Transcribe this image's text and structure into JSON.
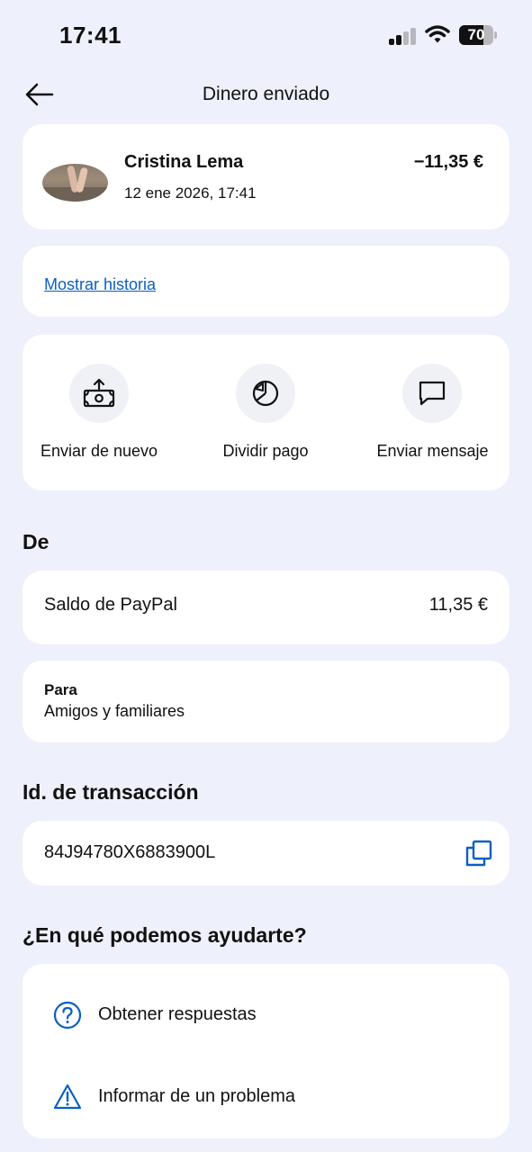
{
  "status_bar": {
    "time": "17:41",
    "battery": "70",
    "battery_level": 0.7
  },
  "header": {
    "title": "Dinero enviado"
  },
  "transaction": {
    "name": "Cristina Lema",
    "date": "12 ene 2026, 17:41",
    "amount": "−11,35 €"
  },
  "history": {
    "link": "Mostrar historia"
  },
  "actions": [
    {
      "label": "Enviar de nuevo",
      "icon": "money-send-icon"
    },
    {
      "label": "Dividir pago",
      "icon": "pie-chart-icon"
    },
    {
      "label": "Enviar mensaje",
      "icon": "message-icon"
    }
  ],
  "from": {
    "title": "De",
    "source": "Saldo de PayPal",
    "amount": "11,35 €"
  },
  "purpose": {
    "label": "Para",
    "value": "Amigos y familiares"
  },
  "transaction_id": {
    "title": "Id. de transacción",
    "value": "84J94780X6883900L"
  },
  "help": {
    "title": "¿En qué podemos ayudarte?",
    "items": [
      {
        "label": "Obtener respuestas",
        "icon": "question-circle-icon"
      },
      {
        "label": "Informar de un problema",
        "icon": "warning-triangle-icon"
      }
    ]
  },
  "colors": {
    "background": "#eef0fb",
    "link": "#0b5fc2",
    "card": "#ffffff"
  }
}
